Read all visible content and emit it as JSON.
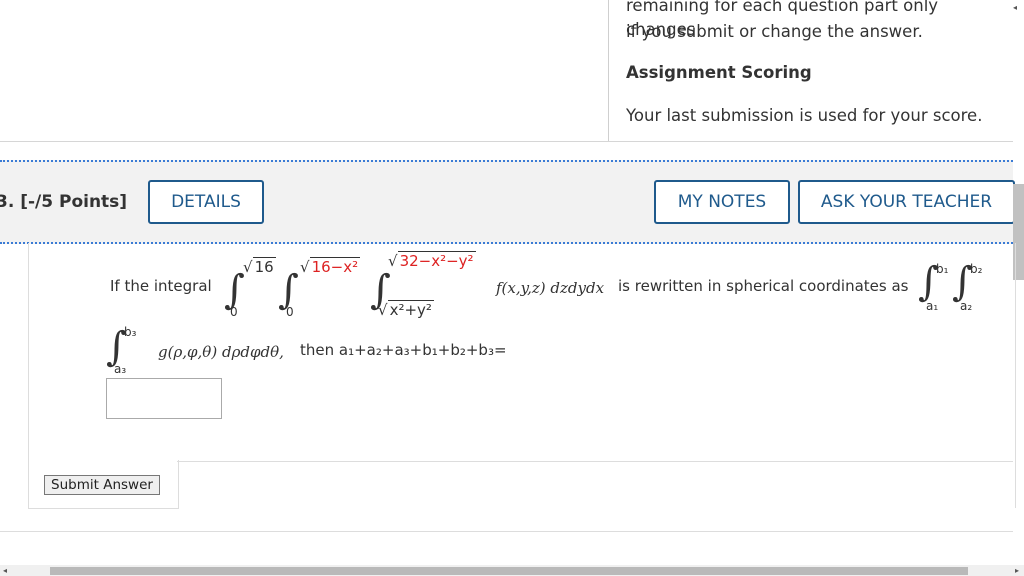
{
  "info": {
    "line1": "remaining for each question part only changes",
    "line2": "if you submit or change the answer.",
    "scoring_heading": "Assignment Scoring",
    "scoring_text": "Your last submission is used for your score."
  },
  "question": {
    "number": "3. [-/5 Points]",
    "details": "DETAILS",
    "my_notes": "MY NOTES",
    "ask_teacher": "ASK YOUR TEACHER"
  },
  "problem": {
    "intro": "If the integral",
    "lower1": "0",
    "upper1": "16",
    "lower2": "0",
    "upper2": "16−x²",
    "lower3": "x²+y²",
    "upper3": "32−x²−y²",
    "integrand": "f(x,y,z) dzdydx",
    "rewrite": "is rewritten in spherical coordinates as",
    "a1": "a₁",
    "b1": "b₁",
    "a2": "a₂",
    "b2": "b₂",
    "a3": "a₃",
    "b3": "b₃",
    "g": "g(ρ,φ,θ) dρdφdθ,",
    "then": "then a₁+a₂+a₃+b₁+b₂+b₃="
  },
  "submit": {
    "label": "Submit Answer"
  }
}
